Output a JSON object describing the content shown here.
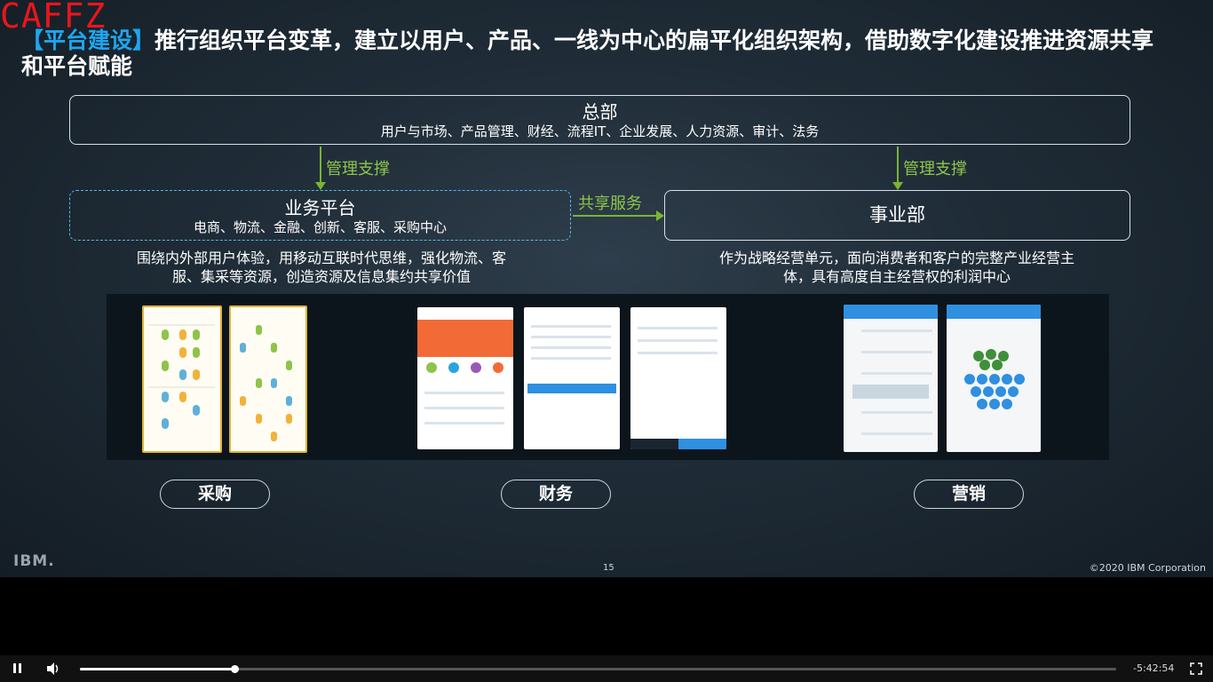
{
  "watermark": "CAFFZ",
  "slide": {
    "title_tag": "【平台建设】",
    "title_text": "推行组织平台变革，建立以用户、产品、一线为中心的扁平化组织架构，借助数字化建设推进资源共享和平台赋能",
    "headquarters": {
      "title": "总部",
      "subtitle": "用户与市场、产品管理、财经、流程IT、企业发展、人力资源、审计、法务"
    },
    "mgmt_support_left": "管理支撑",
    "mgmt_support_right": "管理支撑",
    "business_platform": {
      "title": "业务平台",
      "subtitle": "电商、物流、金融、创新、客服、采购中心"
    },
    "shared_service": "共享服务",
    "business_unit": {
      "title": "事业部"
    },
    "platform_desc_line1": "围绕内外部用户体验，用移动互联时代思维，强化物流、客",
    "platform_desc_line2": "服、集采等资源，创造资源及信息集约共享价值",
    "unit_desc_line1": "作为战略经营单元，面向消费者和客户的完整产业经营主",
    "unit_desc_line2": "体，具有高度自主经营权的利润中心",
    "categories": [
      "采购",
      "财务",
      "营销"
    ],
    "ibm_logo": "IBM.",
    "page_number": "15",
    "copyright": "©2020 IBM Corporation"
  },
  "player": {
    "progress": 0.149,
    "time_remaining": "-5:42:54",
    "icons": [
      "pause-icon",
      "volume-icon",
      "fullscreen-icon"
    ]
  },
  "colors": {
    "accent_blue": "#1ea6f0",
    "green_arrow": "#7ab532",
    "watermark_red": "#e8161c"
  }
}
